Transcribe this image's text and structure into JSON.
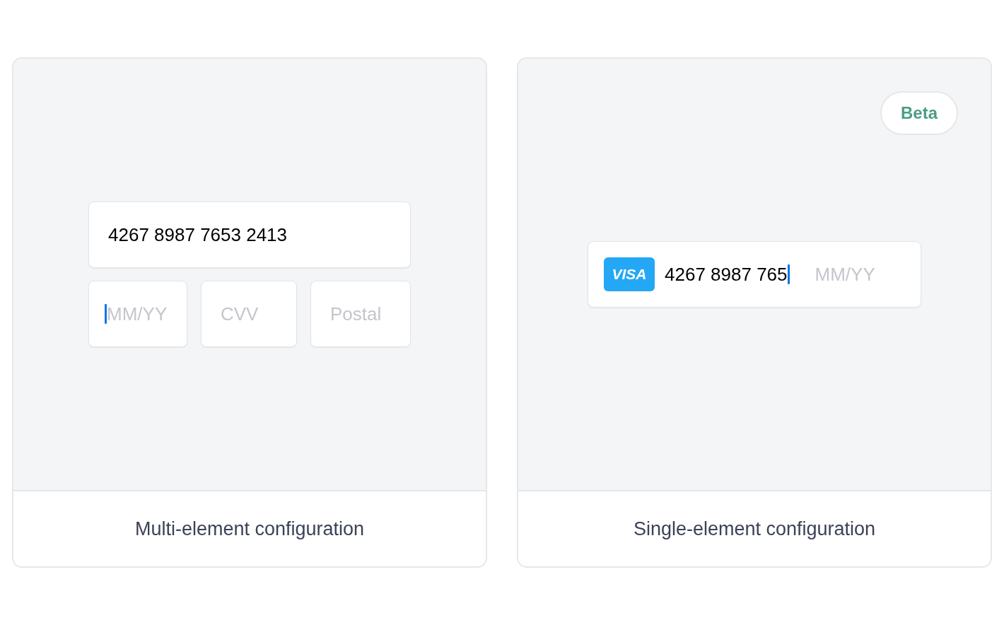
{
  "panels": [
    {
      "kind": "multi",
      "fields": [
        {
          "value": "4267 8987 7653 2413",
          "focused": false
        },
        {
          "placeholder": "MM/YY",
          "focused": true
        },
        {
          "placeholder": "CVV",
          "focused": false
        },
        {
          "placeholder": "Postal",
          "focused": false
        }
      ],
      "caption": "Multi-element configuration"
    },
    {
      "kind": "single",
      "badge": "Beta",
      "card_field": {
        "brand": "VISA",
        "number": "4267 8987 765",
        "focused": true,
        "expiry_placeholder": "MM/YY"
      },
      "caption": "Single-element configuration"
    }
  ]
}
